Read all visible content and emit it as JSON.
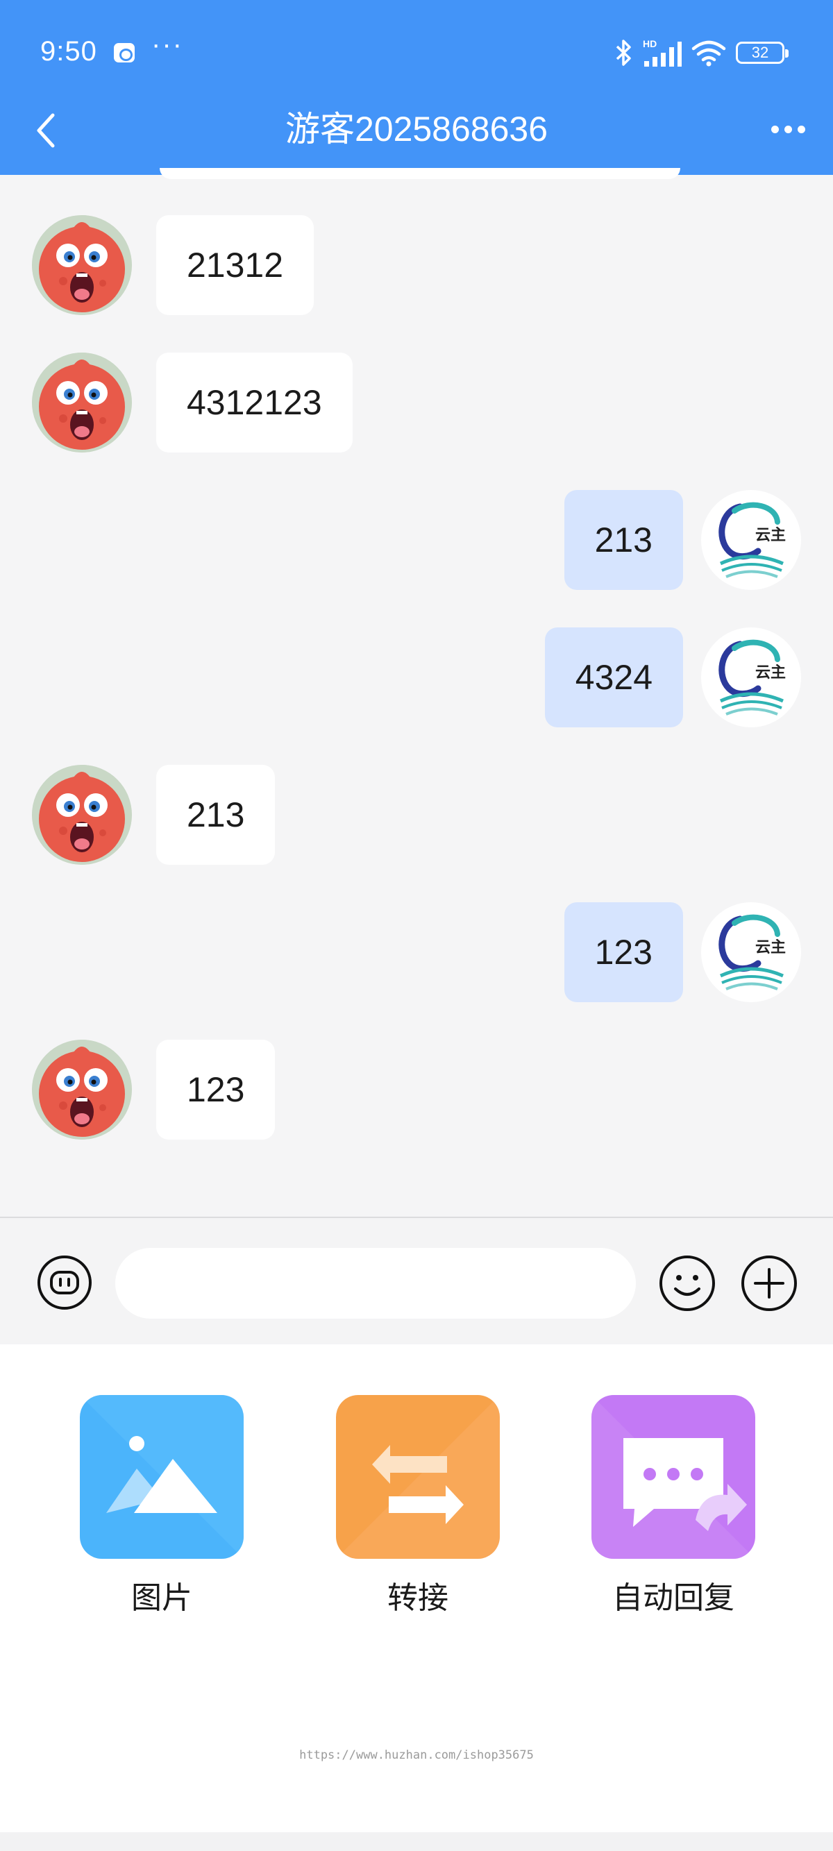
{
  "status_bar": {
    "time": "9:50",
    "more": "···",
    "network": "HD",
    "battery": "32"
  },
  "header": {
    "title": "游客2025868636"
  },
  "messages": [
    {
      "side": "left",
      "text": "21312"
    },
    {
      "side": "left",
      "text": "4312123"
    },
    {
      "side": "right",
      "text": "213"
    },
    {
      "side": "right",
      "text": "4324"
    },
    {
      "side": "left",
      "text": "213"
    },
    {
      "side": "right",
      "text": "123"
    },
    {
      "side": "left",
      "text": "123"
    }
  ],
  "agent_logo_text": "云主",
  "input": {
    "value": "",
    "placeholder": ""
  },
  "tools": [
    {
      "label": "图片",
      "icon": "image-icon",
      "color": "#4bb4fb"
    },
    {
      "label": "转接",
      "icon": "transfer-icon",
      "color": "#f7a24a"
    },
    {
      "label": "自动回复",
      "icon": "auto-reply-icon",
      "color": "#c379f5"
    }
  ],
  "watermark": "https://www.huzhan.com/ishop35675",
  "colors": {
    "header": "#4394f8",
    "agent_bubble": "#d6e4fe",
    "visitor_bubble": "#ffffff"
  }
}
